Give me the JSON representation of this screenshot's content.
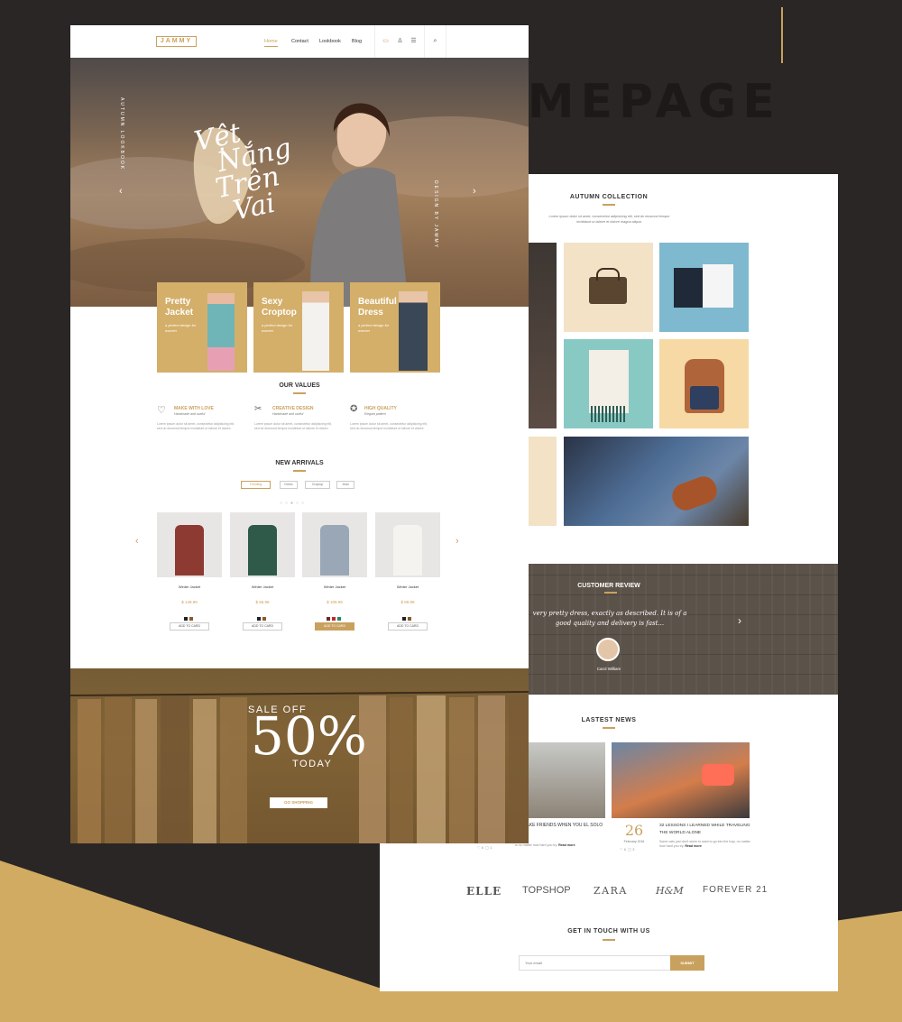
{
  "showcase": {
    "title": "HOMEPAGE"
  },
  "site": {
    "logo": "JAMMY",
    "nav": [
      "Home",
      "Contact",
      "Lookbook",
      "Blog"
    ],
    "nav_icons": [
      "bag-icon",
      "user-icon",
      "menu-icon",
      "search-icon"
    ]
  },
  "hero": {
    "script_lines": [
      "Vệt",
      "Nắng",
      "Trên",
      "Vai"
    ],
    "left_vertical": "AUTUMN LOOKBOOK",
    "right_vertical": "DESIGN BY JAMMY"
  },
  "cards": [
    {
      "title": "Pretty Jacket",
      "sub": "a perfect design for women"
    },
    {
      "title": "Sexy Croptop",
      "sub": "a perfect design for women"
    },
    {
      "title": "Beautiful Dress",
      "sub": "a perfect design for women"
    }
  ],
  "values": {
    "title": "OUR VALUES",
    "items": [
      {
        "title": "MAKE WITH LOVE",
        "sub": "Handmade and useful",
        "text": "Lorem ipsum dolor sit amet, consectetur adipisicing elit, sed do eiusmod tempor incididunt ut labore et dolore.",
        "icon": "heart-icon"
      },
      {
        "title": "CREATIVE DESIGN",
        "sub": "Handmade and useful",
        "text": "Lorem ipsum dolor sit amet, consectetur adipisicing elit, sed do eiusmod tempor incididunt ut labore et dolore.",
        "icon": "scissors-icon"
      },
      {
        "title": "HIGH QUALITY",
        "sub": "Elegant pattern",
        "text": "Lorem ipsum dolor sit amet, consectetur adipisicing elit, sed do eiusmod tempor incididunt ut labore et dolore.",
        "icon": "medal-icon"
      }
    ]
  },
  "arrivals": {
    "title": "NEW ARRIVALS",
    "filters": [
      "Trending",
      "Dress",
      "Croptop",
      "Jean"
    ],
    "products": [
      {
        "name": "Winter Jacket",
        "price": "$ 149.99",
        "button": "ADD TO CARD"
      },
      {
        "name": "Winter Jacket",
        "price": "$ 65.99",
        "button": "ADD TO CARD"
      },
      {
        "name": "Winter Jacket",
        "price": "$ 109.99",
        "button": "ADD TO CARD"
      },
      {
        "name": "Winter Jacket",
        "price": "$ 89.99",
        "button": "ADD TO CARD"
      }
    ]
  },
  "sale": {
    "line1": "SALE OFF",
    "big": "50%",
    "line2": "TODAY",
    "button": "GO SHOPPING"
  },
  "collection": {
    "title": "AUTUMN COLLECTION",
    "text": "Lorem ipsum dolor sit amet, consectetur adipisicing elit, sed do eiusmod tempor incididunt ut labore et dolore magna aliqua."
  },
  "review": {
    "title": "CUSTOMER REVIEW",
    "quote": "very pretty dress, exactly as described. It is of a good quality and delivery is fast...",
    "name": "Carol William"
  },
  "news": {
    "title": "LASTEST NEWS",
    "items": [
      {
        "title": "TO MAKE FRIENDS WHEN YOU EL SOLO",
        "text": "w no matter how hard you try.",
        "more": "Read more",
        "likes": "6",
        "comments": "1"
      },
      {
        "day": "26",
        "month": "February 2016",
        "title": "32 LESSONS I LEARNED WHILE TRAVELING THE WORLD ALONE",
        "text": "Some cats just don't seem to want to go into the trap, no matter how hard you try.",
        "more": "Read more",
        "likes": "6",
        "comments": "3"
      }
    ]
  },
  "brands": [
    "ELLE",
    "TOPSHOP",
    "ZARA",
    "H&M",
    "FOREVER 21"
  ],
  "contact": {
    "title": "GET IN TOUCH WITH US",
    "placeholder": "Your email",
    "button": "SUBMIT"
  }
}
